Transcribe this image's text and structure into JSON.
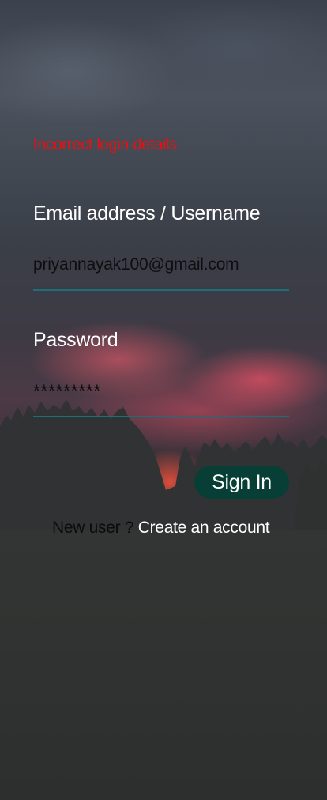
{
  "login": {
    "error_message": "Incorrect login details",
    "email_label": "Email address / Username",
    "email_value": "priyannayak100@gmail.com",
    "password_label": "Password",
    "password_value": "*********",
    "signin_label": "Sign In",
    "new_user_prompt": "New user ?",
    "create_account_label": "Create an account"
  },
  "colors": {
    "error": "#f00d0d",
    "accent_underline": "#1d6f77",
    "button_bg": "#073f37",
    "label_text": "#ffffff",
    "input_text": "#0e0e10"
  }
}
